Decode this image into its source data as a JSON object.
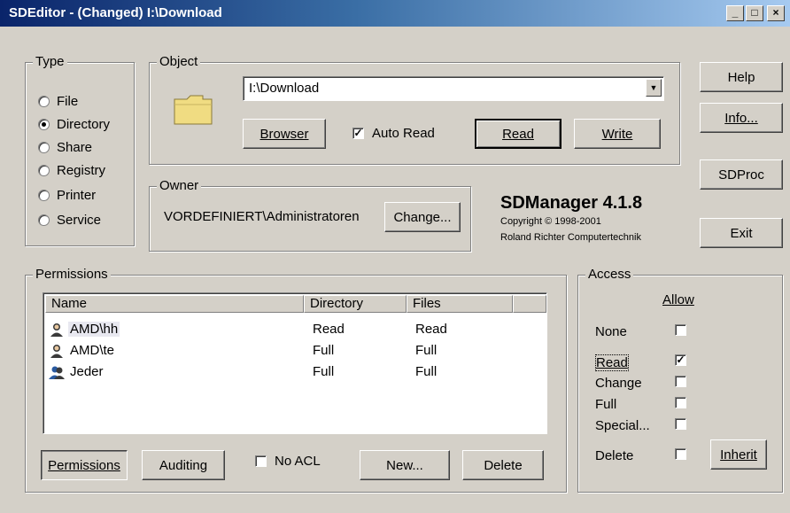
{
  "window": {
    "title": "SDEditor - (Changed) I:\\Download"
  },
  "type_group": {
    "label": "Type",
    "options": [
      "File",
      "Directory",
      "Share",
      "Registry",
      "Printer",
      "Service"
    ],
    "selected": "Directory"
  },
  "object_group": {
    "label": "Object",
    "path_value": "I:\\Download",
    "browser_label": "Browser",
    "auto_read_label": "Auto Read",
    "auto_read_checked": true,
    "read_label": "Read",
    "write_label": "Write"
  },
  "owner_group": {
    "label": "Owner",
    "owner_name": "VORDEFINIERT\\Administratoren",
    "change_label": "Change..."
  },
  "product": {
    "name": "SDManager 4.1.8",
    "copyright": "Copyright © 1998-2001",
    "company": "Roland Richter Computertechnik"
  },
  "side_buttons": {
    "help": "Help",
    "info": "Info...",
    "sdproc": "SDProc",
    "exit": "Exit"
  },
  "permissions_group": {
    "label": "Permissions",
    "columns": [
      "Name",
      "Directory",
      "Files"
    ],
    "rows": [
      {
        "name": "AMD\\hh",
        "directory": "Read",
        "files": "Read",
        "selected": true
      },
      {
        "name": "AMD\\te",
        "directory": "Full",
        "files": "Full"
      },
      {
        "name": "Jeder",
        "directory": "Full",
        "files": "Full"
      }
    ],
    "permissions_button": "Permissions",
    "auditing_button": "Auditing",
    "no_acl_label": "No ACL",
    "new_button": "New...",
    "delete_button": "Delete"
  },
  "access_group": {
    "label": "Access",
    "allow_header": "Allow",
    "items": [
      {
        "label": "None",
        "checked": false
      },
      {
        "label": "Read",
        "checked": true
      },
      {
        "label": "Change",
        "checked": false
      },
      {
        "label": "Full",
        "checked": false
      },
      {
        "label": "Special...",
        "checked": false
      },
      {
        "label": "Delete",
        "checked": false
      }
    ],
    "inherit_button": "Inherit"
  }
}
